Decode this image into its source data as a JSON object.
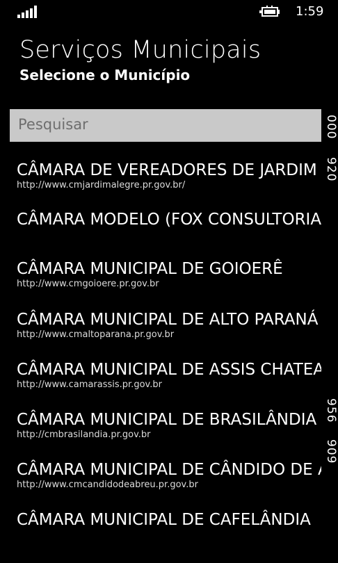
{
  "status_bar": {
    "time": "1:59"
  },
  "header": {
    "title": "Serviços Municipais",
    "subtitle": "Selecione o Município"
  },
  "search": {
    "placeholder": "Pesquisar"
  },
  "items": [
    {
      "title": "CÂMARA DE VEREADORES DE JARDIM ALEGRE",
      "url": "http://www.cmjardimalegre.pr.gov.br/"
    },
    {
      "title": "CÂMARA MODELO (FOX CONSULTORIA - TESTES)",
      "url": ""
    },
    {
      "title": "CÂMARA MUNICIPAL  DE GOIOERÊ",
      "url": "http://www.cmgoioere.pr.gov.br"
    },
    {
      "title": "CÂMARA MUNICIPAL DE ALTO PARANÁ",
      "url": "http://www.cmaltoparana.pr.gov.br"
    },
    {
      "title": "CÂMARA MUNICIPAL DE ASSIS CHATEAUBRIAND",
      "url": "http://www.camarassis.pr.gov.br"
    },
    {
      "title": "CÂMARA MUNICIPAL DE BRASILÂNDIA DO SUL",
      "url": "http://cmbrasilandia.pr.gov.br"
    },
    {
      "title": "CÂMARA MUNICIPAL DE CÂNDIDO DE ABREU",
      "url": "http://www.cmcandidodeabreu.pr.gov.br"
    },
    {
      "title": "CÂMARA MUNICIPAL DE CAFELÂNDIA",
      "url": ""
    }
  ],
  "right_edge_numbers": [
    "000",
    "920",
    "956",
    "909"
  ]
}
